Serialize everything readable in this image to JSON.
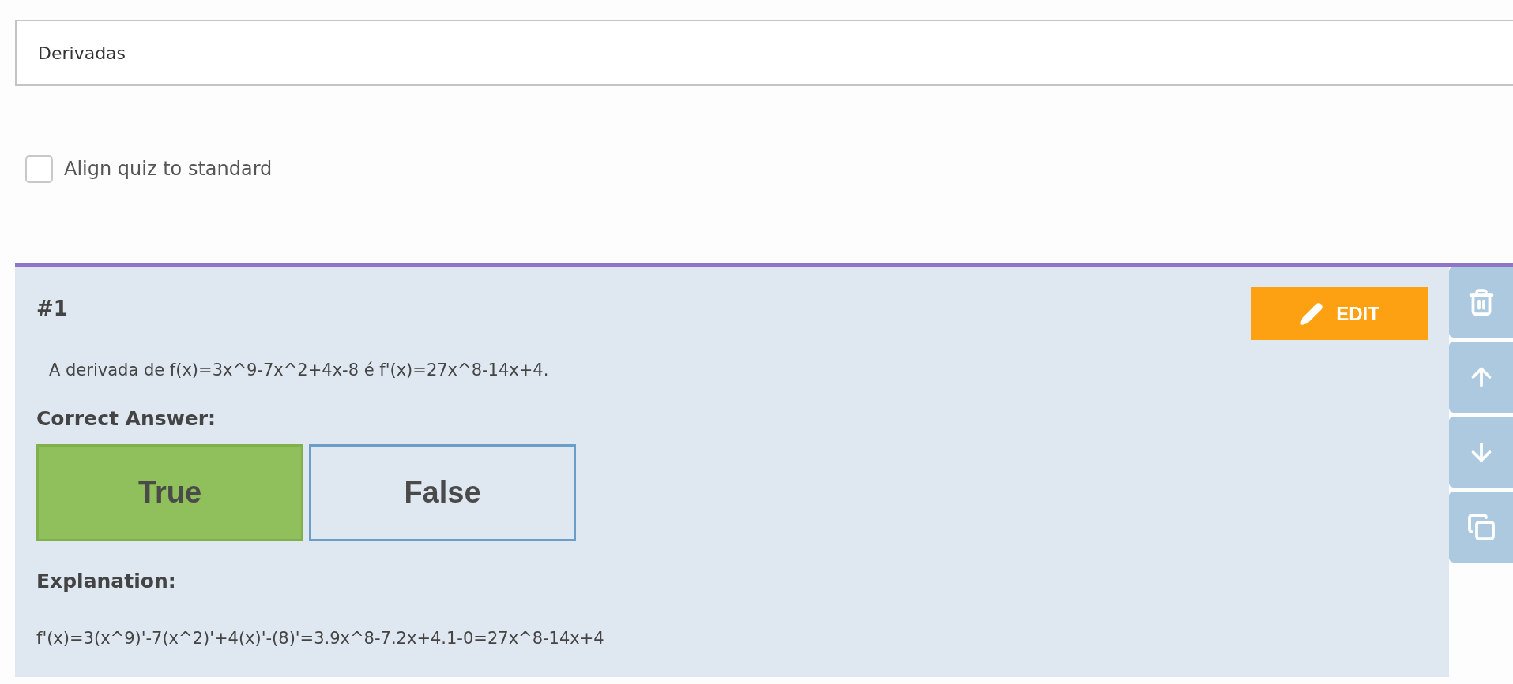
{
  "title_field": {
    "value": "Derivadas"
  },
  "align_checkbox": {
    "label": "Align quiz to standard",
    "checked": false
  },
  "question": {
    "number": "#1",
    "edit_label": "EDIT",
    "text": "A derivada de f(x)=3x^9-7x^2+4x-8 é f'(x)=27x^8-14x+4.",
    "answer_heading": "Correct Answer:",
    "options": [
      {
        "label": "True",
        "selected": true
      },
      {
        "label": "False",
        "selected": false
      }
    ],
    "explanation_heading": "Explanation:",
    "explanation": "f'(x)=3(x^9)'-7(x^2)'+4(x)'-(8)'=3.9x^8-7.2x+4.1-0=27x^8-14x+4"
  }
}
